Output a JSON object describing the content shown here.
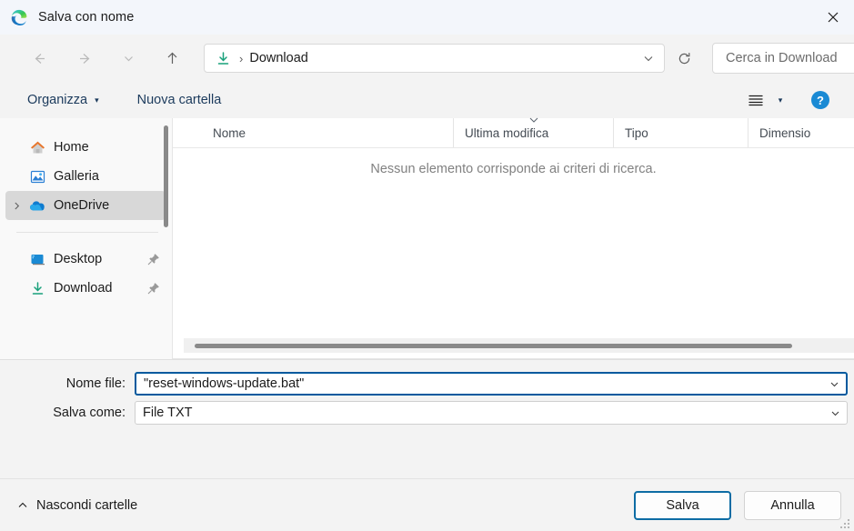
{
  "window": {
    "title": "Salva con nome",
    "app_icon": "edge-logo-icon",
    "close_label": "✕"
  },
  "nav": {
    "back_icon": "arrow-left-icon",
    "forward_icon": "arrow-right-icon",
    "recent_icon": "chevron-down-icon",
    "up_icon": "arrow-up-icon",
    "address": {
      "icon": "download-folder-icon",
      "separator": "›",
      "crumb": "Download",
      "chevron_icon": "chevron-down-icon"
    },
    "refresh_icon": "refresh-icon",
    "search": {
      "placeholder": "Cerca in Download",
      "value": "",
      "icon": "search-icon"
    }
  },
  "commandbar": {
    "organize_label": "Organizza",
    "organize_caret": "▾",
    "new_folder_label": "Nuova cartella",
    "view_icon": "view-list-icon",
    "view_caret": "▾",
    "help_icon": "help-icon"
  },
  "sidebar": {
    "items": [
      {
        "label": "Home",
        "icon": "home-icon",
        "selected": false,
        "pinned": false,
        "expandable": false
      },
      {
        "label": "Galleria",
        "icon": "gallery-icon",
        "selected": false,
        "pinned": false,
        "expandable": false
      },
      {
        "label": "OneDrive",
        "icon": "onedrive-cloud-icon",
        "selected": true,
        "pinned": false,
        "expandable": true
      },
      {
        "label": "Desktop",
        "icon": "desktop-icon",
        "selected": false,
        "pinned": true,
        "expandable": false
      },
      {
        "label": "Download",
        "icon": "download-icon",
        "selected": false,
        "pinned": true,
        "expandable": false
      }
    ]
  },
  "filelist": {
    "columns": [
      {
        "label": "Nome",
        "sorted": false
      },
      {
        "label": "Ultima modifica",
        "sorted": true
      },
      {
        "label": "Tipo",
        "sorted": false
      },
      {
        "label": "Dimensio",
        "sorted": false
      }
    ],
    "empty_message": "Nessun elemento corrisponde ai criteri di ricerca."
  },
  "form": {
    "filename": {
      "label": "Nome file:",
      "value": "\"reset-windows-update.bat\"",
      "focused": true,
      "caret_icon": "chevron-down-icon"
    },
    "filetype": {
      "label": "Salva come:",
      "value": "File TXT",
      "focused": false,
      "caret_icon": "chevron-down-icon"
    }
  },
  "footer": {
    "hide_folders_label": "Nascondi cartelle",
    "hide_folders_icon": "chevron-up-icon",
    "save_label": "Salva",
    "cancel_label": "Annulla",
    "grip_icon": "resize-grip-icon"
  },
  "colors": {
    "accent": "#0d6ca4",
    "focus_border": "#005a9e",
    "title_bar": "#f3f6fb",
    "chrome": "#f3f3f3",
    "download_green": "#1d9e72"
  }
}
